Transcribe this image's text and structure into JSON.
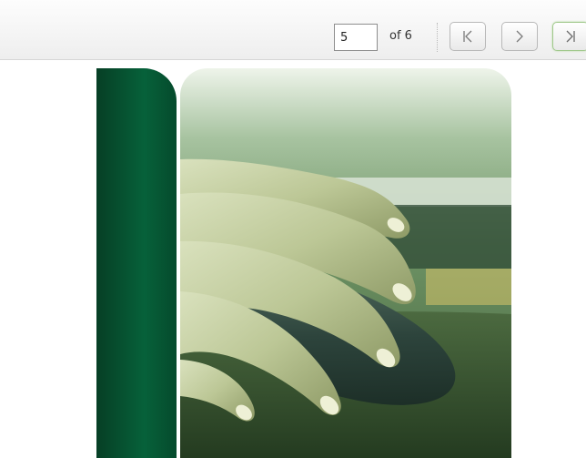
{
  "toolbar": {
    "page_number": "5",
    "page_total": "of 6",
    "first_icon": "first-page-icon",
    "next_icon": "next-page-icon",
    "last_icon": "last-page-icon"
  },
  "colors": {
    "brand_green": "#06613a",
    "active_button_border": "#9fc88a"
  },
  "content": {
    "image_subject": "hand-on-computer-mouse"
  }
}
